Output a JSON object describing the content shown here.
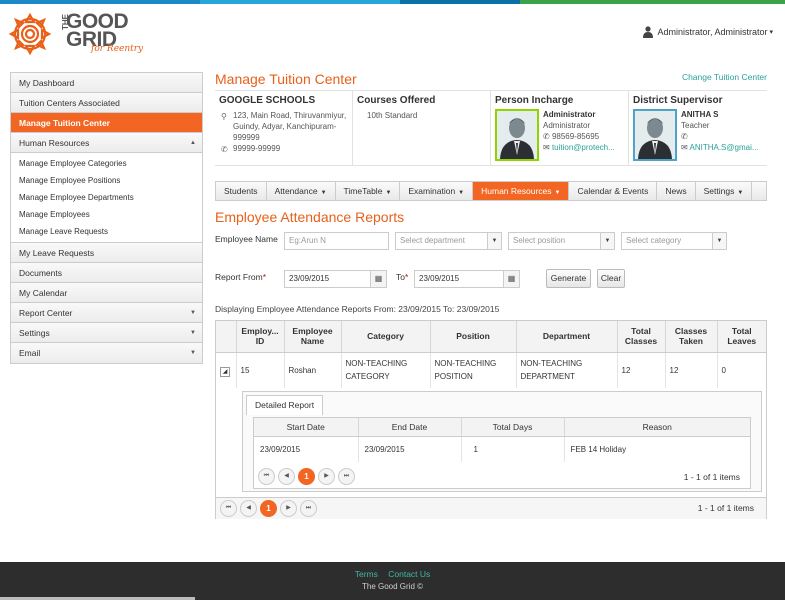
{
  "brand": {
    "the": "THE",
    "line1": "GOOD",
    "line2": "GRID",
    "tagline": "for Reentry"
  },
  "user": {
    "name": "Administrator, Administrator"
  },
  "sidebar": {
    "items_top": [
      "My Dashboard",
      "Tuition Centers Associated",
      "Manage Tuition Center",
      "Human Resources"
    ],
    "hr_sub": [
      "Manage Employee Categories",
      "Manage Employee Positions",
      "Manage Employee Departments",
      "Manage Employees",
      "Manage Leave Requests"
    ],
    "items_bottom": [
      "My Leave Requests",
      "Documents",
      "My Calendar",
      "Report Center",
      "Settings",
      "Email"
    ]
  },
  "page": {
    "title": "Manage Tuition Center",
    "change_link": "Change Tuition Center"
  },
  "info": {
    "school": {
      "title": "GOOGLE SCHOOLS",
      "address": "123, Main Road, Thiruvanmiyur, Guindy, Adyar, Kanchipuram-999999",
      "phone": "99999-99999"
    },
    "courses": {
      "title": "Courses Offered",
      "course": "10th Standard"
    },
    "incharge": {
      "title": "Person Incharge",
      "name": "Administrator",
      "role": "Administrator",
      "phone": "98569-85695",
      "email": "tuition@protech..."
    },
    "supervisor": {
      "title": "District Supervisor",
      "name": "ANITHA S",
      "role": "Teacher",
      "phone": "",
      "email": "ANITHA.S@gmai..."
    }
  },
  "tabs": [
    "Students",
    "Attendance",
    "TimeTable",
    "Examination",
    "Human Resources",
    "Calendar & Events",
    "News",
    "Settings"
  ],
  "report": {
    "title": "Employee Attendance Reports",
    "employee_name_label": "Employee Name",
    "employee_name_placeholder": "Eg:Arun N",
    "dept_placeholder": "Select department",
    "position_placeholder": "Select position",
    "category_placeholder": "Select category",
    "from_label": "Report From",
    "to_label": "To",
    "required": "*",
    "from_date": "23/09/2015",
    "to_date": "23/09/2015",
    "generate": "Generate",
    "clear": "Clear",
    "displaying": "Displaying Employee Attendance Reports From: 23/09/2015 To: 23/09/2015"
  },
  "grid": {
    "headers": [
      "Employ... ID",
      "Employee Name",
      "Category",
      "Position",
      "Department",
      "Total Classes",
      "Classes Taken",
      "Total Leaves"
    ],
    "row": {
      "id": "15",
      "name": "Roshan",
      "category": "NON-TEACHING CATEGORY",
      "position": "NON-TEACHING POSITION",
      "department": "NON-TEACHING DEPARTMENT",
      "total_classes": "12",
      "classes_taken": "12",
      "total_leaves": "0"
    },
    "detail_tab": "Detailed Report",
    "detail_headers": [
      "Start Date",
      "End Date",
      "Total Days",
      "Reason"
    ],
    "detail_row": {
      "start": "23/09/2015",
      "end": "23/09/2015",
      "days": "1",
      "reason": "FEB 14 Holiday"
    },
    "inner_page": "1",
    "inner_info": "1 - 1 of 1 items",
    "outer_page": "1",
    "outer_info": "1 - 1 of 1 items"
  },
  "footer": {
    "terms": "Terms",
    "contact": "Contact Us",
    "copy": "The Good Grid ©"
  },
  "colors": {
    "accent": "#f26522",
    "teal": "#2aa198",
    "footer": "#2d2d2d"
  }
}
